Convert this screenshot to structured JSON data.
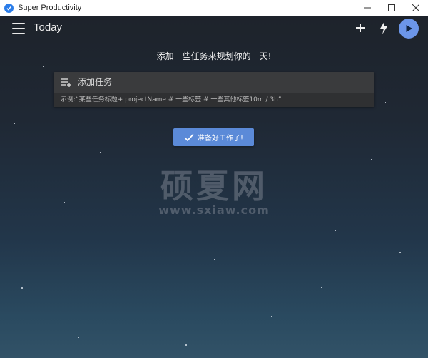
{
  "window": {
    "title": "Super Productivity"
  },
  "header": {
    "page_title": "Today"
  },
  "main": {
    "headline": "添加一些任务来规划你的一天!",
    "task_input_placeholder": "添加任务",
    "task_hint": "示例:“某些任务标题+ projectName # 一些标签 # 一些其他标签10m / 3h”",
    "ready_button_label": "准备好工作了!"
  },
  "watermark": {
    "cn": "硕夏网",
    "en": "www.sxiaw.com"
  },
  "colors": {
    "accent": "#6c96e9",
    "button": "#5b8ad8"
  }
}
